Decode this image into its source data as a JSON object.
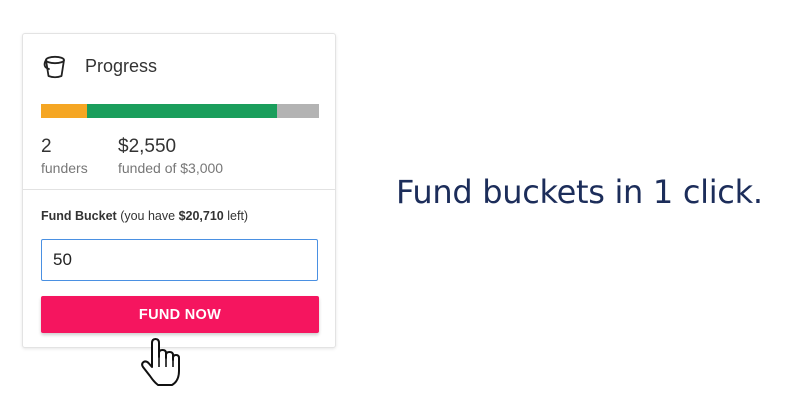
{
  "card": {
    "title": "Progress",
    "icon": "bucket-icon",
    "progress": {
      "goal": 3000,
      "funded": 2550,
      "segments": [
        {
          "name": "pending",
          "fraction": 0.167,
          "color": "#f5a623"
        },
        {
          "name": "funded",
          "fraction": 0.683,
          "color": "#1a9e5c"
        },
        {
          "name": "remaining",
          "fraction": 0.15,
          "color": "#b3b3b3"
        }
      ]
    },
    "stats": {
      "funders_value": "2",
      "funders_label": "funders",
      "funded_value": "$2,550",
      "funded_label": "funded of $3,000"
    },
    "fund_form": {
      "label_bold": "Fund Bucket",
      "label_pre": "(you have",
      "label_amount": "$20,710",
      "label_post": "left)",
      "input_value": "50",
      "button_label": "FUND NOW",
      "button_color": "#f5155f",
      "input_border_color": "#4a90e2"
    }
  },
  "cursor": "hand-pointer-icon",
  "tagline": "Fund buckets in 1 click."
}
